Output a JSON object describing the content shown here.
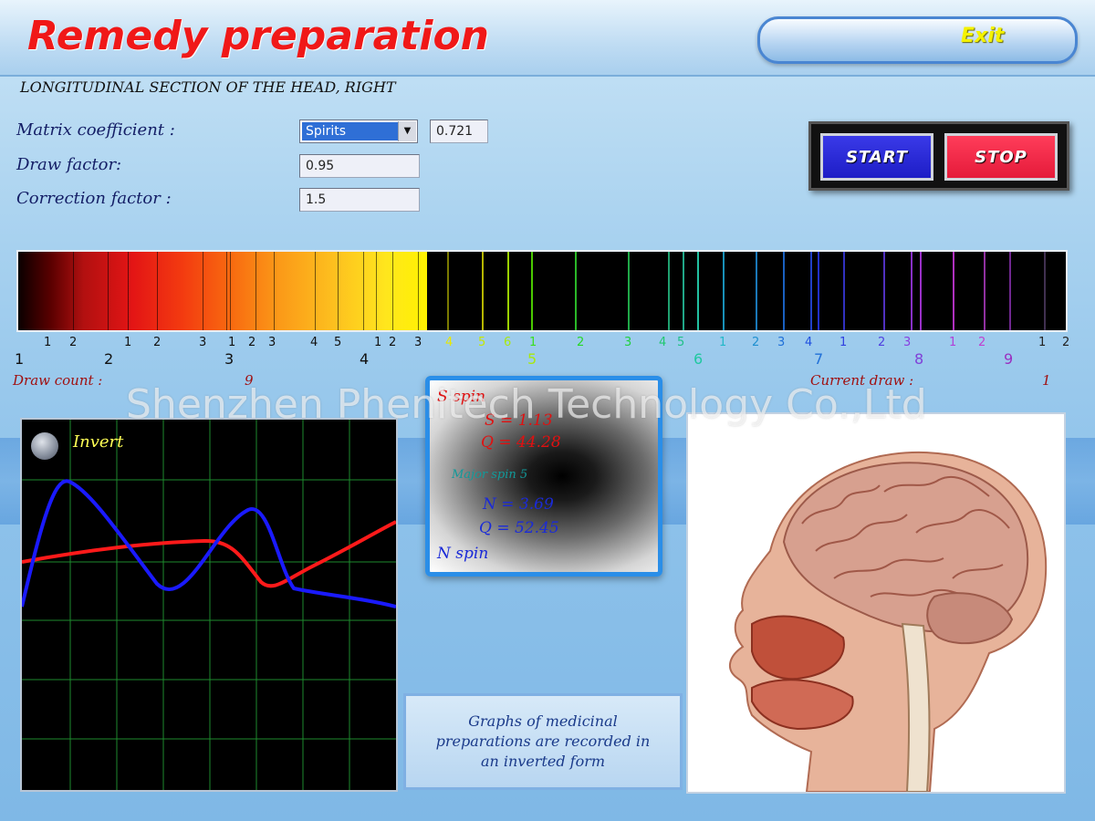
{
  "header": {
    "title": "Remedy preparation",
    "exit_label": "Exit"
  },
  "subtitle": "LONGITUDINAL SECTION OF THE HEAD, RIGHT",
  "form": {
    "matrix_label": "Matrix coefficient :",
    "matrix_selected": "Spirits",
    "matrix_value": "0.721",
    "draw_label": "Draw factor:",
    "draw_value": "0.95",
    "correction_label": "Correction factor :",
    "correction_value": "1.5"
  },
  "controls": {
    "start_label": "START",
    "stop_label": "STOP"
  },
  "spectrum": {
    "warm_minor_ticks": [
      "1",
      "2",
      "1",
      "2",
      "3",
      "1",
      "2",
      "3",
      "4",
      "5",
      "1",
      "2",
      "3"
    ],
    "warm_major_ticks": [
      "1",
      "2",
      "3",
      "4"
    ],
    "cool_minor_ticks": [
      {
        "t": "4",
        "c": "#e8e800"
      },
      {
        "t": "5",
        "c": "#c8e800"
      },
      {
        "t": "6",
        "c": "#a8e810"
      },
      {
        "t": "1",
        "c": "#3adf20"
      },
      {
        "t": "2",
        "c": "#28d828"
      },
      {
        "t": "3",
        "c": "#20d040"
      },
      {
        "t": "4",
        "c": "#20c870"
      },
      {
        "t": "5",
        "c": "#20c088"
      },
      {
        "t": "1",
        "c": "#22b8c8"
      },
      {
        "t": "2",
        "c": "#2090d0"
      },
      {
        "t": "3",
        "c": "#2070d8"
      },
      {
        "t": "4",
        "c": "#2050e0"
      },
      {
        "t": "1",
        "c": "#3040e0"
      },
      {
        "t": "2",
        "c": "#5040e0"
      },
      {
        "t": "3",
        "c": "#8840e0"
      },
      {
        "t": "1",
        "c": "#b040d8"
      },
      {
        "t": "2",
        "c": "#c040d0"
      },
      {
        "t": "1",
        "c": "#222222"
      },
      {
        "t": "2",
        "c": "#222222"
      }
    ],
    "cool_major_ticks": [
      {
        "t": "5",
        "c": "#a8e810"
      },
      {
        "t": "6",
        "c": "#20c8a0"
      },
      {
        "t": "7",
        "c": "#2070d8"
      },
      {
        "t": "8",
        "c": "#8040d8"
      },
      {
        "t": "9",
        "c": "#9a30c0"
      }
    ]
  },
  "counts": {
    "draw_count_label": "Draw count :",
    "draw_count_value": "9",
    "current_draw_label": "Current draw :",
    "current_draw_value": "1"
  },
  "graph": {
    "invert_label": "Invert"
  },
  "spin": {
    "s_label": "S spin",
    "s_value": "S = 1.13",
    "s_q": "Q = 44.28",
    "major": "Major spin 5",
    "n_value": "N = 3.69",
    "n_q": "Q = 52.45",
    "n_label": "N spin"
  },
  "caption": "Graphs of medicinal preparations are recorded in an inverted form",
  "watermark": "Shenzhen Phenitech Technology Co.,Ltd",
  "colors": {
    "title": "#f01818",
    "exit": "#f4f200",
    "start": "#1d1dc6",
    "stop": "#e51a3a",
    "graph_red": "#ff1a1a",
    "graph_blue": "#1a1aff",
    "grid": "#1e8a2e"
  }
}
